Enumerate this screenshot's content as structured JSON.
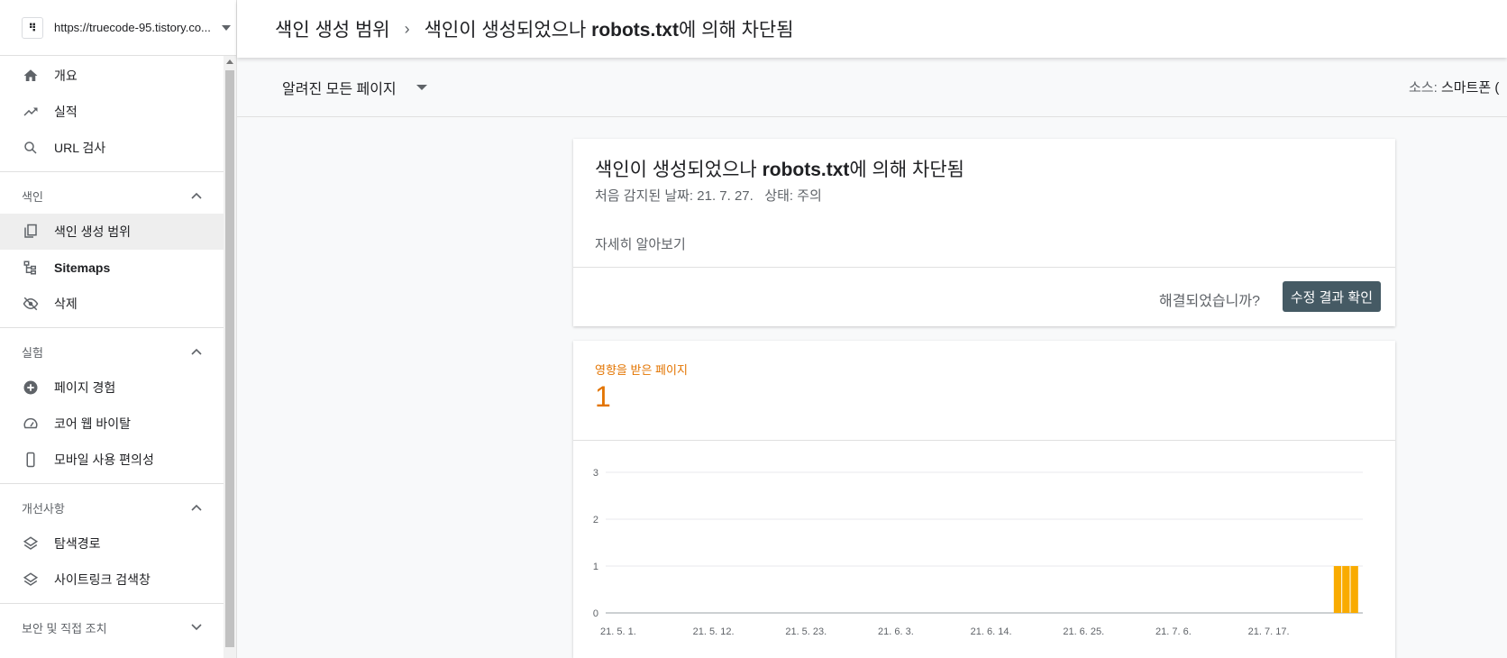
{
  "property": {
    "logo": "⠻",
    "url": "https://truecode-95.tistory.co..."
  },
  "nav": {
    "top": [
      {
        "label": "개요",
        "icon": "home-icon"
      },
      {
        "label": "실적",
        "icon": "trending-up-icon"
      },
      {
        "label": "URL 검사",
        "icon": "search-icon"
      }
    ],
    "index": {
      "title": "색인",
      "items": [
        {
          "label": "색인 생성 범위",
          "icon": "file-copy-icon"
        },
        {
          "label": "Sitemaps",
          "icon": "sitemap-icon"
        },
        {
          "label": "삭제",
          "icon": "eye-off-icon"
        }
      ]
    },
    "experience": {
      "title": "실험",
      "items": [
        {
          "label": "페이지 경험",
          "icon": "plus-circle-icon"
        },
        {
          "label": "코어 웹 바이탈",
          "icon": "speedometer-icon"
        },
        {
          "label": "모바일 사용 편의성",
          "icon": "phone-icon"
        }
      ]
    },
    "enhancements": {
      "title": "개선사항",
      "items": [
        {
          "label": "탐색경로",
          "icon": "layers-icon"
        },
        {
          "label": "사이트링크 검색창",
          "icon": "layers-icon"
        }
      ]
    },
    "security": {
      "title": "보안 및 직접 조치"
    }
  },
  "header": {
    "crumb": "색인 생성 범위",
    "sep": "›",
    "issue_pre": "색인이 생성되었으나 ",
    "issue_bold": "robots.txt",
    "issue_post": "에 의해 차단됨"
  },
  "filter": {
    "selected": "알려진 모든 페이지",
    "source_label": "소스:",
    "source_value": "스마트폰 ("
  },
  "detail": {
    "title_pre": "색인이 생성되었으나 ",
    "title_bold": "robots.txt",
    "title_post": "에 의해 차단됨",
    "subtitle": "처음 감지된 날짜: 21. 7. 27.   상태: 주의",
    "learn_more": "자세히 알아보기",
    "question": "해결되었습니까?",
    "validate_button": "수정 결과 확인"
  },
  "affected": {
    "label": "영향을 받은 페이지",
    "count": "1"
  },
  "colors": {
    "accent": "#e37400",
    "bar": "#f9ab00",
    "button": "#455a64"
  },
  "chart_data": {
    "type": "bar",
    "title": "",
    "xlabel": "",
    "ylabel": "",
    "ylim": [
      0,
      3
    ],
    "yticks": [
      "0",
      "1",
      "2",
      "3"
    ],
    "xticks": [
      "21. 5. 1.",
      "21. 5. 12.",
      "21. 5. 23.",
      "21. 6. 3.",
      "21. 6. 14.",
      "21. 6. 25.",
      "21. 7. 6.",
      "21. 7. 17."
    ],
    "x_start": "2021-05-01",
    "x_end": "2021-07-30",
    "series": [
      {
        "values": [
          {
            "x": "2021-07-27",
            "y": 1
          },
          {
            "x": "2021-07-28",
            "y": 1
          },
          {
            "x": "2021-07-29",
            "y": 1
          }
        ]
      }
    ]
  }
}
